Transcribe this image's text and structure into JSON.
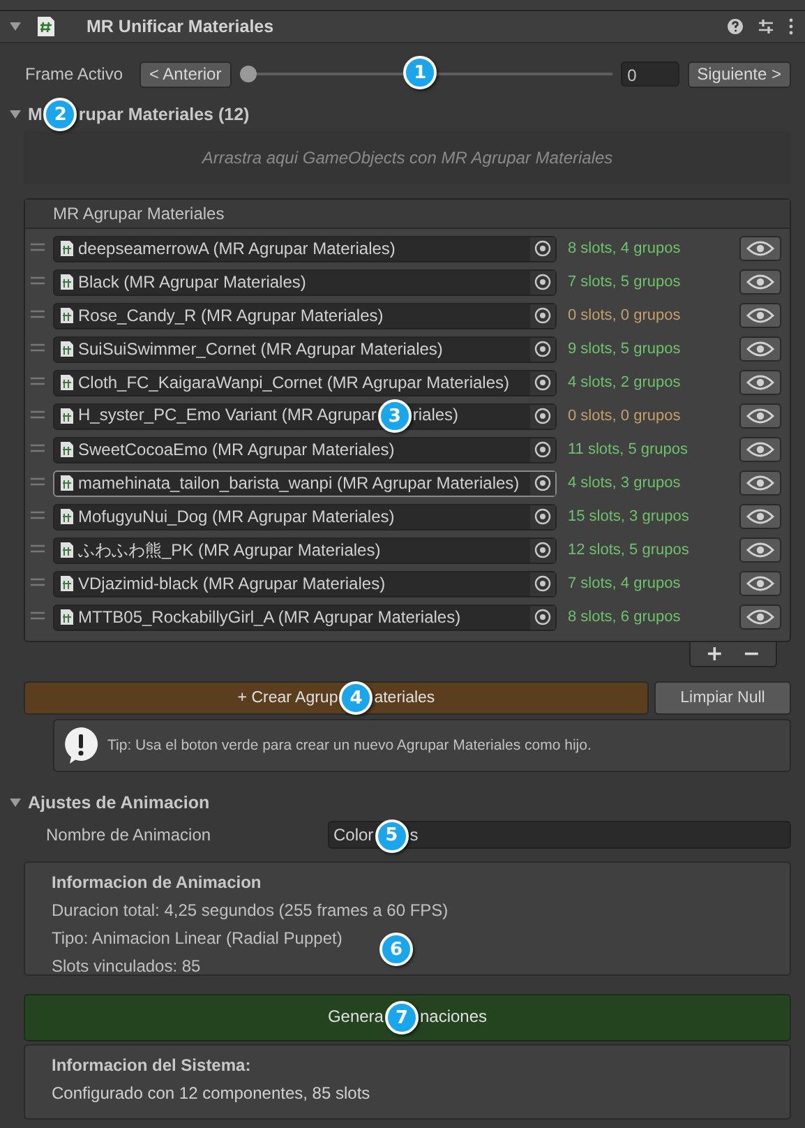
{
  "component": {
    "title": "MR Unificar Materiales",
    "expanded": true
  },
  "frame": {
    "label": "Frame Activo",
    "prev_button": "< Anterior",
    "level": 0,
    "value": "0",
    "next_button": "Siguiente >",
    "badge": "1"
  },
  "groups": {
    "title_parts": [
      "M",
      "rupar Materiales (12)"
    ],
    "badge": "2",
    "expanded": true,
    "drop_hint": "Arrastra aqui GameObjects con MR Agrupar Materiales"
  },
  "list": {
    "header": "MR Agrupar Materiales",
    "add": "+",
    "remove": "−",
    "rows": [
      {
        "name_parts": [
          "deepseamerrowA (MR Agrupar Materiales)"
        ],
        "status": "8 slots, 4 grupos",
        "color": "#6dc26a",
        "selected": false
      },
      {
        "name_parts": [
          "Black (MR Agrupar Materiales)"
        ],
        "status": "7 slots, 5 grupos",
        "color": "#6dc26a",
        "selected": false
      },
      {
        "name_parts": [
          "Rose_Candy_R (MR Agrupar Materiales)"
        ],
        "status": "0 slots, 0 grupos",
        "color": "#c4a068",
        "selected": false
      },
      {
        "name_parts": [
          "SuiSuiSwimmer_Cornet (MR Agrupar Materiales)"
        ],
        "status": "9 slots, 5 grupos",
        "color": "#6dc26a",
        "selected": false
      },
      {
        "name_parts": [
          "Cloth_FC_KaigaraWanpi_Cornet (MR Agrupar Materiales)"
        ],
        "status": "4 slots, 2 grupos",
        "color": "#6dc26a",
        "selected": false
      },
      {
        "name_parts": [
          "H_syster_PC_Emo Variant (MR Agrupar",
          "riales)"
        ],
        "badge": "3",
        "status": "0 slots, 0 grupos",
        "color": "#c4a068",
        "selected": false
      },
      {
        "name_parts": [
          "SweetCocoaEmo (MR Agrupar Materiales)"
        ],
        "status": "11 slots, 5 grupos",
        "color": "#6dc26a",
        "selected": false
      },
      {
        "name_parts": [
          "mamehinata_tailon_barista_wanpi (MR Agrupar Materiales)"
        ],
        "status": "4 slots, 3 grupos",
        "color": "#6dc26a",
        "selected": true
      },
      {
        "name_parts": [
          "MofugyuNui_Dog (MR Agrupar Materiales)"
        ],
        "status": "15 slots, 3 grupos",
        "color": "#6dc26a",
        "selected": false
      },
      {
        "name_parts": [
          "ふわふわ熊_PK (MR Agrupar Materiales)"
        ],
        "status": "12 slots, 5 grupos",
        "color": "#6dc26a",
        "selected": false
      },
      {
        "name_parts": [
          "VDjazimid-black (MR Agrupar Materiales)"
        ],
        "status": "7 slots, 4 grupos",
        "color": "#6dc26a",
        "selected": false
      },
      {
        "name_parts": [
          "MTTB05_RockabillyGirl_A (MR Agrupar Materiales)"
        ],
        "status": "8 slots, 6 grupos",
        "color": "#6dc26a",
        "selected": false
      }
    ]
  },
  "create_button": {
    "label_parts": [
      "+ Crear Agrup",
      "ateriales"
    ],
    "badge": "4"
  },
  "clear_button": "Limpiar Null",
  "tip": "Tip: Usa el boton verde para crear un nuevo Agrupar Materiales como hijo.",
  "animation": {
    "title": "Ajustes de Animacion",
    "expanded": true,
    "name_label": "Nombre de Animacion",
    "name_value_parts": [
      "Color",
      "s"
    ],
    "badge": "5"
  },
  "anim_info": {
    "title": "Informacion de Animacion",
    "lines": [
      "Duracion total: 4,25 segundos (255 frames a 60 FPS)",
      "Tipo: Animacion Linear (Radial Puppet)",
      "Slots vinculados: 85"
    ],
    "badge": "6"
  },
  "generate_button": {
    "label_parts": [
      "Genera",
      "naciones"
    ],
    "badge": "7"
  },
  "system_info": {
    "title": "Informacion del Sistema:",
    "line": "Configurado con 12 componentes, 85 slots"
  }
}
